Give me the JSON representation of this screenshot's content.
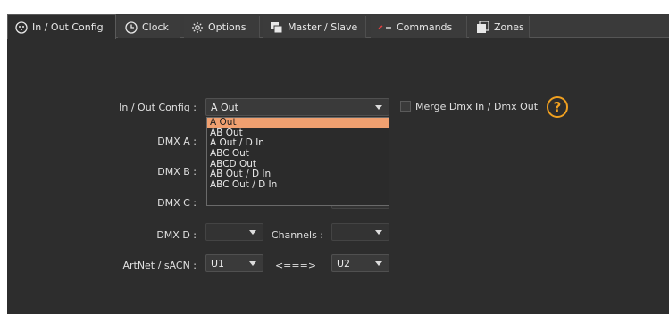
{
  "tabs": [
    {
      "label": "In / Out Config",
      "icon": "dmx-connector-icon"
    },
    {
      "label": "Clock",
      "icon": "clock-icon"
    },
    {
      "label": "Options",
      "icon": "gear-icon"
    },
    {
      "label": "Master / Slave",
      "icon": "master-slave-icon"
    },
    {
      "label": "Commands",
      "icon": "commands-icon"
    },
    {
      "label": "Zones",
      "icon": "zones-icon"
    }
  ],
  "config": {
    "inout_label": "In / Out Config :",
    "inout_value": "A Out",
    "merge_label": "Merge Dmx In / Dmx Out",
    "help_glyph": "?",
    "dmx_a_label": "DMX A :",
    "dmx_b_label": "DMX B :",
    "dmx_c_label": "DMX C :",
    "dmx_d_label": "DMX D :",
    "channels_label": "Channels :",
    "artnet_label": "ArtNet / sACN :",
    "artnet_value": "U1",
    "arrow_text": "<===>",
    "artnet_right_value": "U2"
  },
  "dropdown": {
    "options": [
      "A Out",
      "AB Out",
      "A Out / D In",
      "ABC Out",
      "ABCD Out",
      "AB Out / D In",
      "ABC Out / D In"
    ],
    "selected_index": 0
  },
  "colors": {
    "panel_bg": "#2d2d2d",
    "accent_orange": "#f0a020",
    "selected_item": "#f0a070"
  }
}
